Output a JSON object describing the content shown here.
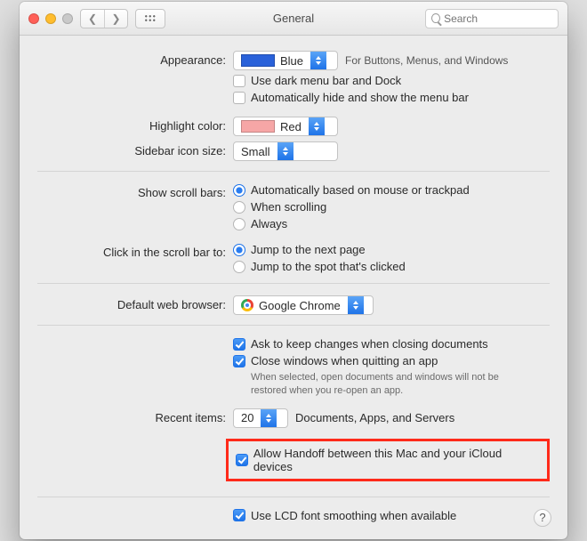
{
  "window": {
    "title": "General"
  },
  "toolbar": {
    "search_placeholder": "Search"
  },
  "labels": {
    "appearance": "Appearance:",
    "highlight": "Highlight color:",
    "sidebar": "Sidebar icon size:",
    "scrollbars": "Show scroll bars:",
    "clickbar": "Click in the scroll bar to:",
    "browser": "Default web browser:",
    "recent": "Recent items:"
  },
  "appearance": {
    "value": "Blue",
    "hint": "For Buttons, Menus, and Windows",
    "dark_menu": "Use dark menu bar and Dock",
    "auto_hide": "Automatically hide and show the menu bar"
  },
  "highlight": {
    "value": "Red"
  },
  "sidebar": {
    "value": "Small"
  },
  "scrollbars": {
    "opt1": "Automatically based on mouse or trackpad",
    "opt2": "When scrolling",
    "opt3": "Always"
  },
  "clickbar": {
    "opt1": "Jump to the next page",
    "opt2": "Jump to the spot that's clicked"
  },
  "browser": {
    "value": "Google Chrome"
  },
  "closing": {
    "ask": "Ask to keep changes when closing documents",
    "close_windows": "Close windows when quitting an app",
    "note": "When selected, open documents and windows will not be restored when you re-open an app."
  },
  "recent": {
    "value": "20",
    "suffix": "Documents, Apps, and Servers"
  },
  "handoff": "Allow Handoff between this Mac and your iCloud devices",
  "lcd": "Use LCD font smoothing when available"
}
